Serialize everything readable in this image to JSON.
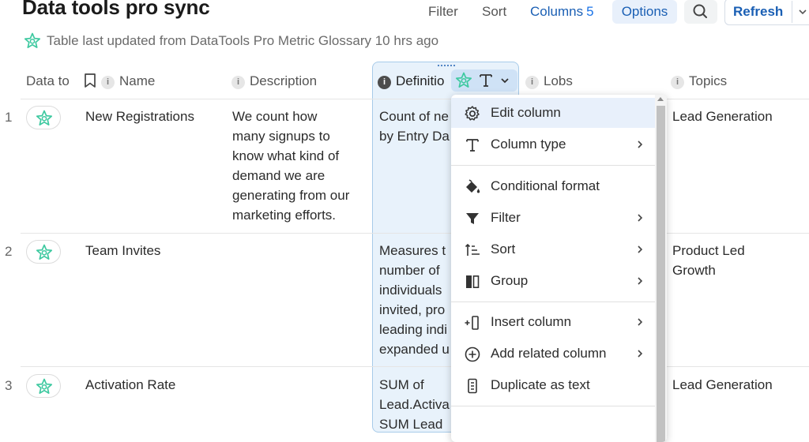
{
  "header": {
    "title": "Data tools pro sync",
    "filter_label": "Filter",
    "sort_label": "Sort",
    "columns_label": "Columns",
    "columns_count": "5",
    "options_label": "Options",
    "refresh_label": "Refresh",
    "subtitle": "Table last updated from DataTools Pro Metric Glossary 10 hrs ago"
  },
  "columns": {
    "data_to": "Data to",
    "name": "Name",
    "description": "Description",
    "definition": "Definitio",
    "lobs": "Lobs",
    "topics": "Topics"
  },
  "rows": [
    {
      "num": "1",
      "name": "New Registrations",
      "description": [
        "We count how",
        "many signups to",
        "know what kind of",
        "demand we are",
        "generating from our",
        "marketing efforts."
      ],
      "definition": [
        "Count of ne",
        "by Entry Da"
      ],
      "topics": [
        "Lead Generation"
      ]
    },
    {
      "num": "2",
      "name": "Team Invites",
      "description": [],
      "definition": [
        "Measures t",
        "number of",
        "individuals",
        "invited, pro",
        "leading indi",
        "expanded u"
      ],
      "topics": [
        "Product Led",
        "Growth"
      ]
    },
    {
      "num": "3",
      "name": "Activation Rate",
      "description": [],
      "definition": [
        "SUM of",
        "Lead.Activa",
        "SUM Lead"
      ],
      "topics": [
        "Lead Generation"
      ]
    }
  ],
  "menu": {
    "items": [
      {
        "label": "Edit column",
        "icon": "gear-icon",
        "submenu": false
      },
      {
        "label": "Column type",
        "icon": "text-type-icon",
        "submenu": true
      },
      {
        "label": "Conditional format",
        "icon": "paint-bucket-icon",
        "submenu": false
      },
      {
        "label": "Filter",
        "icon": "filter-icon",
        "submenu": true
      },
      {
        "label": "Sort",
        "icon": "sort-icon",
        "submenu": true
      },
      {
        "label": "Group",
        "icon": "group-icon",
        "submenu": true
      },
      {
        "label": "Insert column",
        "icon": "insert-column-icon",
        "submenu": true
      },
      {
        "label": "Add related column",
        "icon": "add-circle-icon",
        "submenu": true
      },
      {
        "label": "Duplicate as text",
        "icon": "duplicate-icon",
        "submenu": false
      }
    ]
  },
  "colors": {
    "accent": "#1a5fb4",
    "brand_green": "#3ec9a0",
    "highlight": "#e8f2fb"
  }
}
